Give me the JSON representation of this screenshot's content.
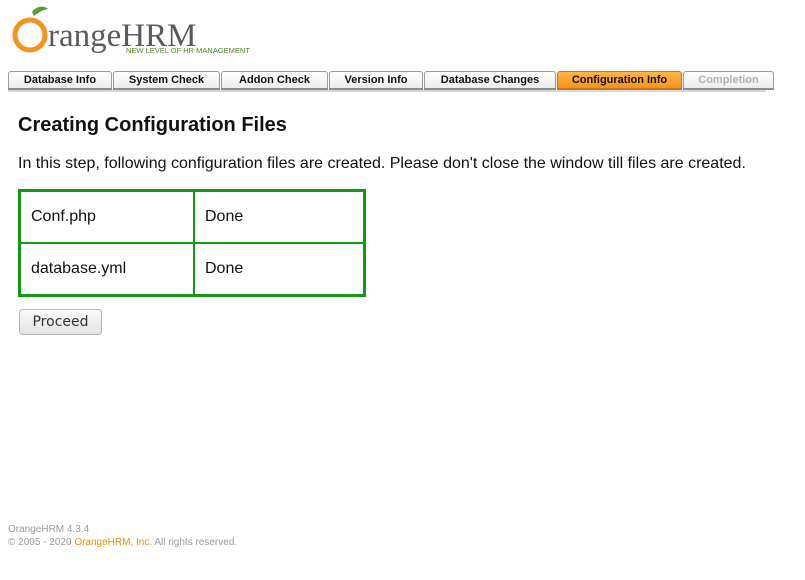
{
  "logo": {
    "brand_main": "rangeHRM",
    "brand_lead": "O",
    "tagline": "NEW LEVEL OF HR MANAGEMENT"
  },
  "tabs": [
    {
      "label": "Database Info",
      "state": "normal"
    },
    {
      "label": "System Check",
      "state": "normal"
    },
    {
      "label": "Addon Check",
      "state": "normal"
    },
    {
      "label": "Version Info",
      "state": "normal"
    },
    {
      "label": "Database Changes",
      "state": "normal"
    },
    {
      "label": "Configuration Info",
      "state": "active"
    },
    {
      "label": "Completion",
      "state": "disabled"
    }
  ],
  "main": {
    "title": "Creating Configuration Files",
    "description": "In this step, following configuration files are created. Please don't close the window till files are created.",
    "files": [
      {
        "name": "Conf.php",
        "status": "Done"
      },
      {
        "name": "database.yml",
        "status": "Done"
      }
    ],
    "proceed_label": "Proceed"
  },
  "footer": {
    "version": "OrangeHRM 4.3.4",
    "copyright_prefix": "© 2005 - 2020 ",
    "company_link": "OrangeHRM, Inc.",
    "rights": " All rights reserved."
  },
  "colors": {
    "accent": "#f6921e",
    "table_border": "#129a12",
    "link": "#f08c00"
  }
}
